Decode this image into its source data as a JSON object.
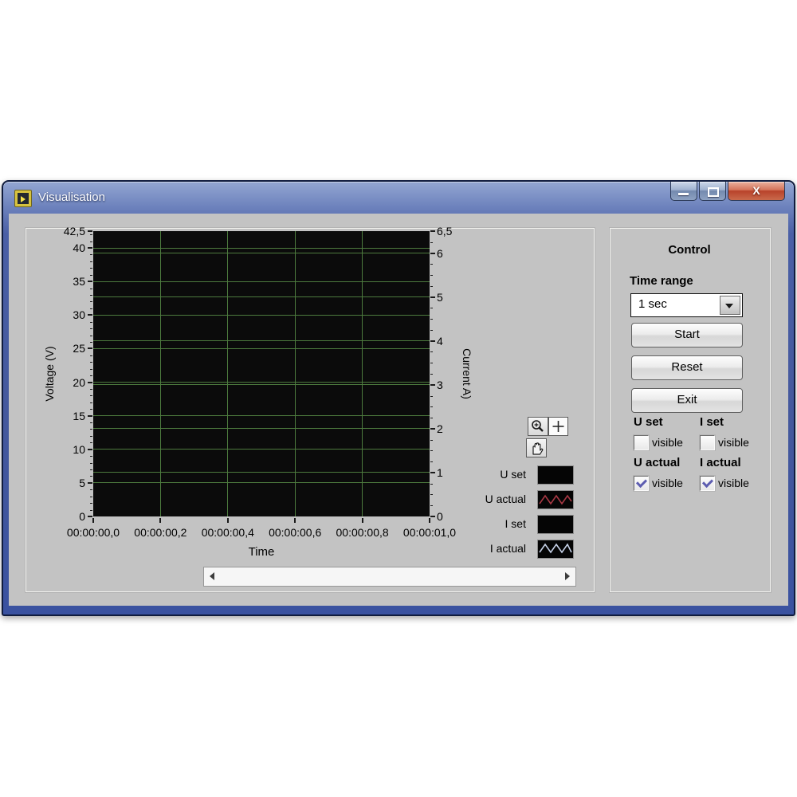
{
  "window": {
    "title": "Visualisation",
    "close_glyph": "X",
    "icons": {
      "app": "labview-vi-icon",
      "minimize": "minimize-bar-icon",
      "maximize": "restore-square-icon",
      "close": "close-x-icon"
    }
  },
  "chart_data": {
    "type": "line",
    "title": "",
    "xlabel": "Time",
    "plot_bg": "#0b0b0b",
    "grid_color": "#4d7b3e",
    "grid_on": true,
    "x_axis": {
      "tick_labels": [
        "00:00:00,0",
        "00:00:00,2",
        "00:00:00,4",
        "00:00:00,6",
        "00:00:00,8",
        "00:00:01,0"
      ],
      "tick_fractions": [
        0,
        0.2,
        0.4,
        0.6,
        0.8,
        1.0
      ],
      "grid_fractions": [
        0.2,
        0.4,
        0.6,
        0.8
      ]
    },
    "y_left": {
      "label": "Voltage (V)",
      "range": [
        0,
        42.5
      ],
      "tick_values": [
        42.5,
        40,
        35,
        30,
        25,
        20,
        15,
        10,
        5,
        0
      ],
      "tick_labels": [
        "42,5",
        "40",
        "35",
        "30",
        "25",
        "20",
        "15",
        "10",
        "5",
        "0"
      ],
      "grid_values": [
        5,
        10,
        15,
        20,
        25,
        30,
        35,
        40
      ],
      "minor_step": 1
    },
    "y_right": {
      "label": "Current A)",
      "range": [
        0,
        6.5
      ],
      "tick_values": [
        6.5,
        6,
        5,
        4,
        3,
        2,
        1,
        0
      ],
      "tick_labels": [
        "6,5",
        "6",
        "5",
        "4",
        "3",
        "2",
        "1",
        "0"
      ],
      "grid_values": [
        1,
        2,
        3,
        4,
        5,
        6
      ],
      "minor_step": 0.25
    },
    "series": [
      {
        "name": "U set",
        "color": "#000000",
        "visible": false,
        "values": []
      },
      {
        "name": "U actual",
        "color": "#a83844",
        "visible": true,
        "values": []
      },
      {
        "name": "I set",
        "color": "#000000",
        "visible": false,
        "values": []
      },
      {
        "name": "I actual",
        "color": "#c7d2e8",
        "visible": true,
        "values": []
      }
    ],
    "legend_position": "right"
  },
  "legend": {
    "items": [
      {
        "label": "U set",
        "swatch": "solid",
        "color": "#000000"
      },
      {
        "label": "U actual",
        "swatch": "zigzag",
        "color": "#a83844"
      },
      {
        "label": "I set",
        "swatch": "solid",
        "color": "#000000"
      },
      {
        "label": "I actual",
        "swatch": "zigzag",
        "color": "#c7d2e8"
      }
    ]
  },
  "palette": {
    "tools": [
      {
        "name": "zoom",
        "icon": "magnifier-plus-icon"
      },
      {
        "name": "crosshair",
        "icon": "plus-cursor-icon"
      },
      {
        "name": "pan",
        "icon": "hand-icon"
      }
    ]
  },
  "control": {
    "heading": "Control",
    "time_range_label": "Time range",
    "time_range_value": "1 sec",
    "buttons": [
      "Start",
      "Reset",
      "Exit"
    ],
    "channels": [
      {
        "label": "U set",
        "checkbox_label": "visible",
        "checked": false
      },
      {
        "label": "I set",
        "checkbox_label": "visible",
        "checked": false
      },
      {
        "label": "U actual",
        "checkbox_label": "visible",
        "checked": true
      },
      {
        "label": "I actual",
        "checkbox_label": "visible",
        "checked": true
      }
    ]
  }
}
